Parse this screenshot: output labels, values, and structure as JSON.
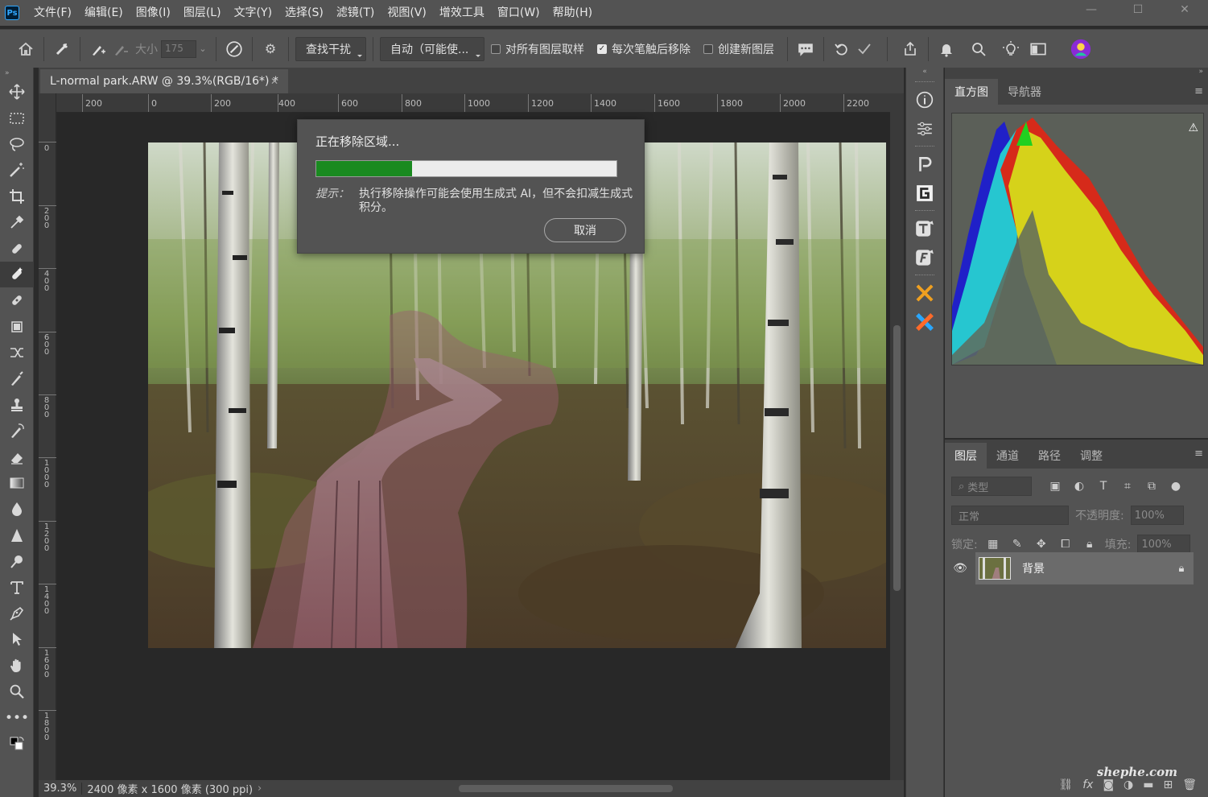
{
  "app": {
    "logo": "Ps"
  },
  "menu": [
    "文件(F)",
    "编辑(E)",
    "图像(I)",
    "图层(L)",
    "文字(Y)",
    "选择(S)",
    "滤镜(T)",
    "视图(V)",
    "增效工具",
    "窗口(W)",
    "帮助(H)"
  ],
  "window_controls": {
    "minimize": "—",
    "maximize": "☐",
    "close": "✕"
  },
  "options": {
    "size_label": "大小",
    "size_value": "175",
    "find_distractions": "查找干扰",
    "mode": "自动（可能使...",
    "sample_all_layers": {
      "label": "对所有图层取样",
      "checked": false
    },
    "remove_after_stroke": {
      "label": "每次笔触后移除",
      "checked": true
    },
    "new_layer": {
      "label": "创建新图层",
      "checked": false
    }
  },
  "document": {
    "tab_title": "L-normal park.ARW @ 39.3%(RGB/16*) *",
    "ruler_h": [
      "200",
      "0",
      "200",
      "400",
      "600",
      "800",
      "1000",
      "1200",
      "1400",
      "1600",
      "1800",
      "2000",
      "2200"
    ],
    "ruler_v": [
      "0",
      "200",
      "400",
      "600",
      "800",
      "1000",
      "1200",
      "1400",
      "1600",
      "1800"
    ],
    "zoom": "39.3%",
    "dimensions": "2400 像素 x 1600 像素 (300 ppi)"
  },
  "dialog": {
    "title": "正在移除区域...",
    "progress": 0.32,
    "hint_label": "提示：",
    "hint_text": "执行移除操作可能会使用生成式 AI，但不会扣减生成式积分。",
    "cancel_label": "取消"
  },
  "histogram_panel": {
    "tabs": [
      "直方图",
      "导航器"
    ],
    "active_tab": 0
  },
  "layers_panel": {
    "tabs": [
      "图层",
      "通道",
      "路径",
      "调整"
    ],
    "active_tab": 0,
    "filter_label": "类型",
    "blend_mode": "正常",
    "opacity_label": "不透明度:",
    "opacity_value": "100%",
    "lock_label": "锁定:",
    "fill_label": "填充:",
    "fill_value": "100%",
    "layers": [
      {
        "name": "背景",
        "visible": true,
        "locked": true
      }
    ]
  },
  "watermark": "shephe.com",
  "colors": {
    "progress_fill": "#1a8a20",
    "chrome": "#535353",
    "canvas_bg": "#282828"
  }
}
